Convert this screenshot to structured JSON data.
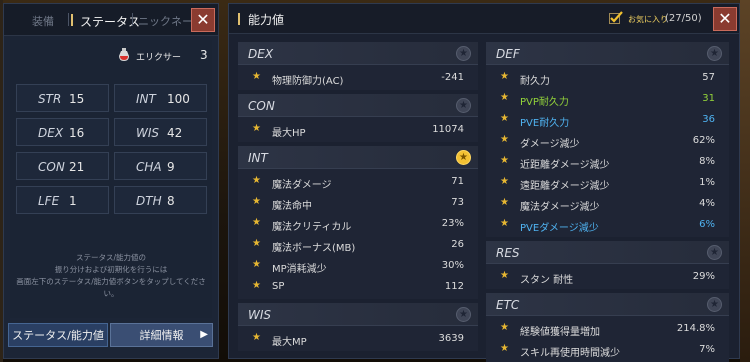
{
  "left": {
    "tabs": [
      {
        "label": "装備"
      },
      {
        "label": "ステータス"
      },
      {
        "label": "ニックネーム"
      }
    ],
    "close": "✕",
    "elixir": {
      "label": "エリクサー",
      "count": "3"
    },
    "stats": [
      {
        "key": "STR",
        "value": "15"
      },
      {
        "key": "INT",
        "value": "100"
      },
      {
        "key": "DEX",
        "value": "16"
      },
      {
        "key": "WIS",
        "value": "42"
      },
      {
        "key": "CON",
        "value": "21"
      },
      {
        "key": "CHA",
        "value": "9"
      },
      {
        "key": "LFE",
        "value": "1"
      },
      {
        "key": "DTH",
        "value": "8"
      }
    ],
    "note": [
      "ステータス/能力値の",
      "振り分けおよび初期化を行うには",
      "画面左下のステータス/能力値ボタンをタップしてください。"
    ],
    "buttons": {
      "status": "ステータス/能力値",
      "detail": "詳細情報",
      "arrow": "▶"
    }
  },
  "right": {
    "title": "能力値",
    "favorite": {
      "label": "お気に入り",
      "count": "(27/50)"
    },
    "close": "✕",
    "sections_left": [
      {
        "name": "DEX",
        "starred": false,
        "rows": [
          {
            "label": "物理防御力(AC)",
            "value": "-241",
            "color": ""
          }
        ]
      },
      {
        "name": "CON",
        "starred": false,
        "rows": [
          {
            "label": "最大HP",
            "value": "11074",
            "color": ""
          }
        ]
      },
      {
        "name": "INT",
        "starred": true,
        "rows": [
          {
            "label": "魔法ダメージ",
            "value": "71",
            "color": ""
          },
          {
            "label": "魔法命中",
            "value": "73",
            "color": ""
          },
          {
            "label": "魔法クリティカル",
            "value": "23%",
            "color": ""
          },
          {
            "label": "魔法ボーナス(MB)",
            "value": "26",
            "color": ""
          },
          {
            "label": "MP消耗減少",
            "value": "30%",
            "color": ""
          },
          {
            "label": "SP",
            "value": "112",
            "color": ""
          }
        ]
      },
      {
        "name": "WIS",
        "starred": false,
        "rows": [
          {
            "label": "最大MP",
            "value": "3639",
            "color": ""
          }
        ]
      }
    ],
    "sections_right": [
      {
        "name": "DEF",
        "starred": false,
        "rows": [
          {
            "label": "耐久力",
            "value": "57",
            "color": ""
          },
          {
            "label": "PVP耐久力",
            "value": "31",
            "color": "green"
          },
          {
            "label": "PVE耐久力",
            "value": "36",
            "color": "blue"
          },
          {
            "label": "ダメージ減少",
            "value": "62%",
            "color": ""
          },
          {
            "label": "近距離ダメージ減少",
            "value": "8%",
            "color": ""
          },
          {
            "label": "遠距離ダメージ減少",
            "value": "1%",
            "color": ""
          },
          {
            "label": "魔法ダメージ減少",
            "value": "4%",
            "color": ""
          },
          {
            "label": "PVEダメージ減少",
            "value": "6%",
            "color": "blue"
          }
        ]
      },
      {
        "name": "RES",
        "starred": false,
        "rows": [
          {
            "label": "スタン 耐性",
            "value": "29%",
            "color": ""
          }
        ]
      },
      {
        "name": "ETC",
        "starred": false,
        "rows": [
          {
            "label": "経験値獲得量増加",
            "value": "214.8%",
            "color": ""
          },
          {
            "label": "スキル再使用時間減少",
            "value": "7%",
            "color": ""
          }
        ]
      }
    ]
  },
  "colors": {
    "accent": "#e0c070",
    "star": "#f3c133",
    "green": "#93d33a",
    "blue": "#4fb2f0",
    "close": "#8a3b30"
  }
}
